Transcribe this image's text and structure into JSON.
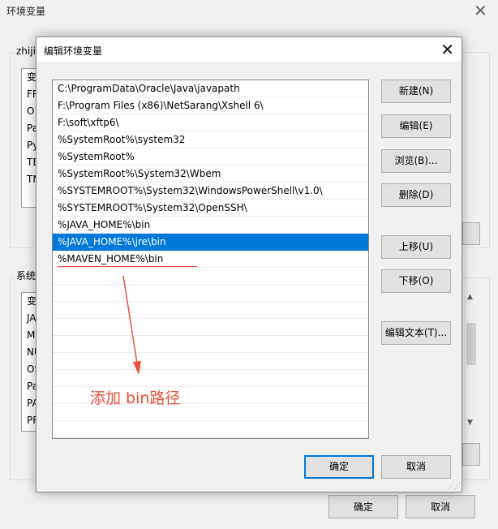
{
  "parent_window": {
    "title": "环境变量",
    "close_symbol": "✕",
    "user_group_label": "zhiji",
    "user_list": [
      "变",
      "FR",
      "O",
      "Pa",
      "Py",
      "TE",
      "TM"
    ],
    "system_group_label": "系统",
    "system_list": [
      "变",
      "JA",
      "M",
      "NU",
      "OS",
      "Pa",
      "PA",
      "PR"
    ],
    "ok_label": "确定",
    "cancel_label": "取消"
  },
  "dialog": {
    "title": "编辑环境变量",
    "close_symbol": "✕",
    "paths": [
      "C:\\ProgramData\\Oracle\\Java\\javapath",
      "F:\\Program Files (x86)\\NetSarang\\Xshell 6\\",
      "F:\\soft\\xftp6\\",
      "%SystemRoot%\\system32",
      "%SystemRoot%",
      "%SystemRoot%\\System32\\Wbem",
      "%SYSTEMROOT%\\System32\\WindowsPowerShell\\v1.0\\",
      "%SYSTEMROOT%\\System32\\OpenSSH\\",
      "%JAVA_HOME%\\bin",
      "%JAVA_HOME%\\jre\\bin",
      "%MAVEN_HOME%\\bin"
    ],
    "selected_index": 9,
    "buttons": {
      "new": "新建(N)",
      "edit": "编辑(E)",
      "browse": "浏览(B)...",
      "delete": "删除(D)",
      "move_up": "上移(U)",
      "move_down": "下移(O)",
      "edit_text": "编辑文本(T)..."
    },
    "ok_label": "确定",
    "cancel_label": "取消"
  },
  "annotation": {
    "text": "添加 bin路径",
    "color": "#e8503a"
  },
  "colors": {
    "selection": "#0078d7",
    "dialog_bg": "#f0f0f0"
  }
}
